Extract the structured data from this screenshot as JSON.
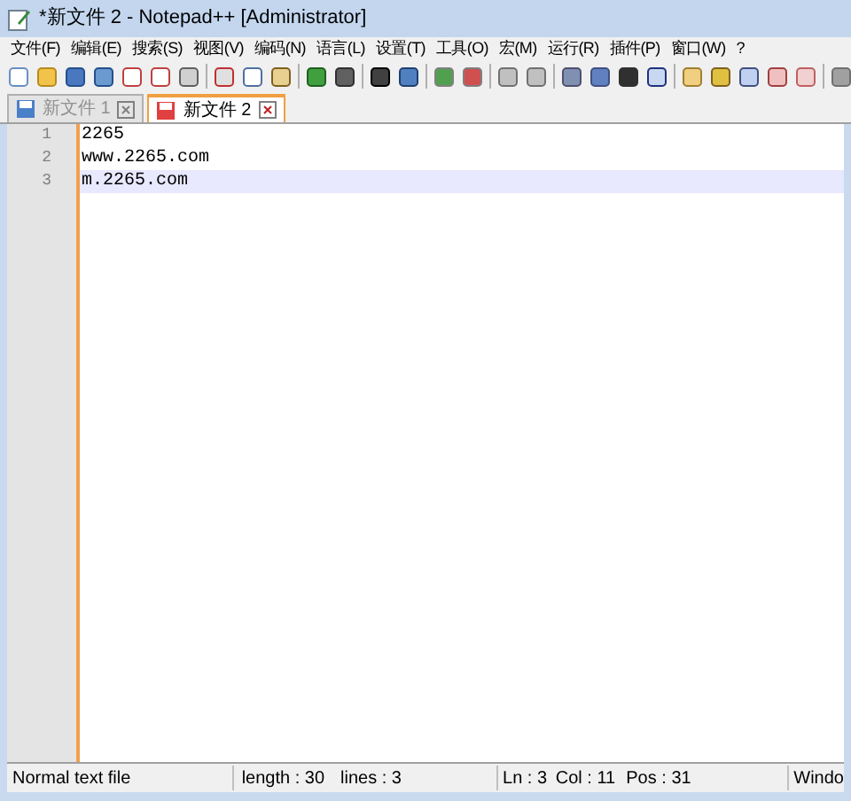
{
  "window": {
    "title": "*新文件 2 - Notepad++ [Administrator]"
  },
  "menu": [
    "文件(F)",
    "编辑(E)",
    "搜索(S)",
    "视图(V)",
    "编码(N)",
    "语言(L)",
    "设置(T)",
    "工具(O)",
    "宏(M)",
    "运行(R)",
    "插件(P)",
    "窗口(W)",
    "?"
  ],
  "tabs": [
    {
      "label": "新文件 1",
      "selected": false
    },
    {
      "label": "新文件 2",
      "selected": true
    }
  ],
  "editor": {
    "lines": [
      {
        "number": "1",
        "text": "2265",
        "current": false
      },
      {
        "number": "2",
        "text": "www.2265.com",
        "current": false
      },
      {
        "number": "3",
        "text": "m.2265.com",
        "current": true
      }
    ]
  },
  "status_bar": {
    "file_type": "Normal text file",
    "length": "length : 30",
    "lines": "lines : 3",
    "ln": "Ln : 3",
    "col": "Col : 11",
    "pos": "Pos : 31",
    "eol": "Windo"
  }
}
